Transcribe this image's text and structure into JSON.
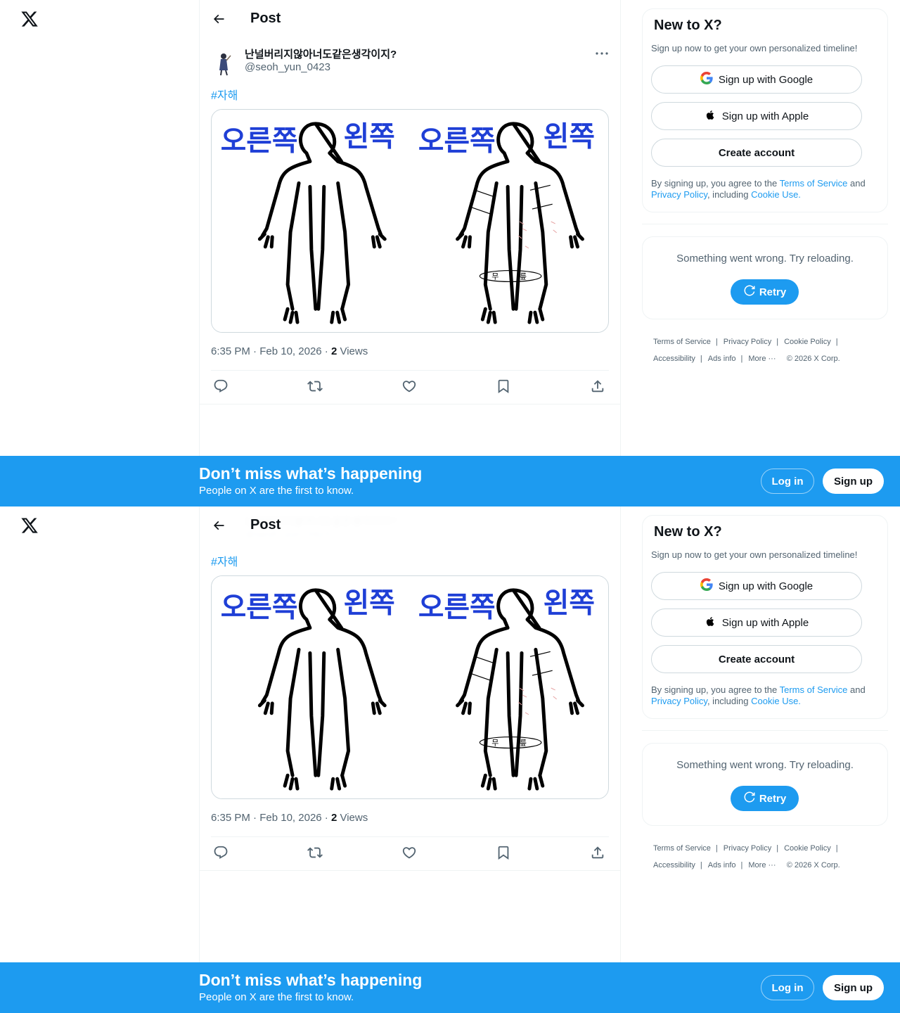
{
  "brand": {
    "accent": "#1d9bf0",
    "text": "#0f1419",
    "muted": "#536471"
  },
  "header": {
    "title": "Post"
  },
  "post": {
    "display_name": "난널버리지않아너도같은생각이지?",
    "handle": "@seoh_yun_0423",
    "hashtag": "#자해",
    "time": "6:35 PM",
    "date": "Feb 10, 2026",
    "views_count": "2",
    "views_label": "Views",
    "image_labels": {
      "left_a": "오른쪽",
      "right_a": "왼쪽",
      "left_b": "오른쪽",
      "right_b": "왼쪽"
    },
    "image_small_marks": {
      "thigh_left": "무",
      "thigh_right": "릎"
    }
  },
  "actions": [
    "reply-icon",
    "repost-icon",
    "like-icon",
    "bookmark-icon",
    "share-icon"
  ],
  "signup": {
    "title": "New to X?",
    "subtitle": "Sign up now to get your own personalized timeline!",
    "google": "Sign up with Google",
    "apple": "Sign up with Apple",
    "create": "Create account",
    "legal_prefix": "By signing up, you agree to the ",
    "terms": "Terms of Service",
    "and": " and ",
    "privacy": "Privacy Policy",
    "including": ", including ",
    "cookie": "Cookie Use."
  },
  "error": {
    "text": "Something went wrong. Try reloading.",
    "retry": "Retry"
  },
  "footer": {
    "terms": "Terms of Service",
    "privacy": "Privacy Policy",
    "cookie": "Cookie Policy",
    "accessibility": "Accessibility",
    "ads": "Ads info",
    "more": "More",
    "copyright": "© 2026 X Corp."
  },
  "banner": {
    "title": "Don’t miss what’s happening",
    "subtitle": "People on X are the first to know.",
    "login": "Log in",
    "signup": "Sign up"
  }
}
